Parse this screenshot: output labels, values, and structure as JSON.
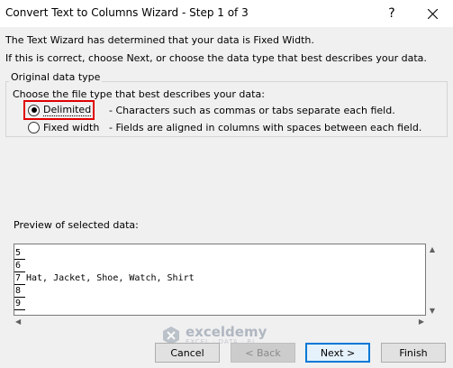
{
  "window": {
    "title": "Convert Text to Columns Wizard - Step 1 of 3",
    "help_glyph": "?",
    "close_icon": "close-icon"
  },
  "intro": {
    "line1": "The Text Wizard has determined that your data is Fixed Width.",
    "line2": "If this is correct, choose Next, or choose the data type that best describes your data."
  },
  "original_data_type": {
    "group_label": "Original data type",
    "prompt": "Choose the file type that best describes your data:",
    "options": [
      {
        "label": "Delimited",
        "description": "- Characters such as commas or tabs separate each field.",
        "checked": true
      },
      {
        "label": "Fixed width",
        "description": "- Fields are aligned in columns with spaces between each field.",
        "checked": false
      }
    ]
  },
  "preview": {
    "label": "Preview of selected data:",
    "line_numbers": [
      "5",
      "6",
      "7",
      "8",
      "9",
      ""
    ],
    "rows": [
      "Hat, Jacket, Shoe, Watch, Shirt",
      "",
      "",
      "",
      "",
      ""
    ]
  },
  "watermark": {
    "brand": "exceldemy",
    "tagline": "EXCEL · DATA · BI"
  },
  "buttons": {
    "cancel": "Cancel",
    "back": "< Back",
    "next": "Next >",
    "finish": "Finish"
  },
  "colors": {
    "highlight": "#e00000",
    "default_button_border": "#0078d7"
  }
}
